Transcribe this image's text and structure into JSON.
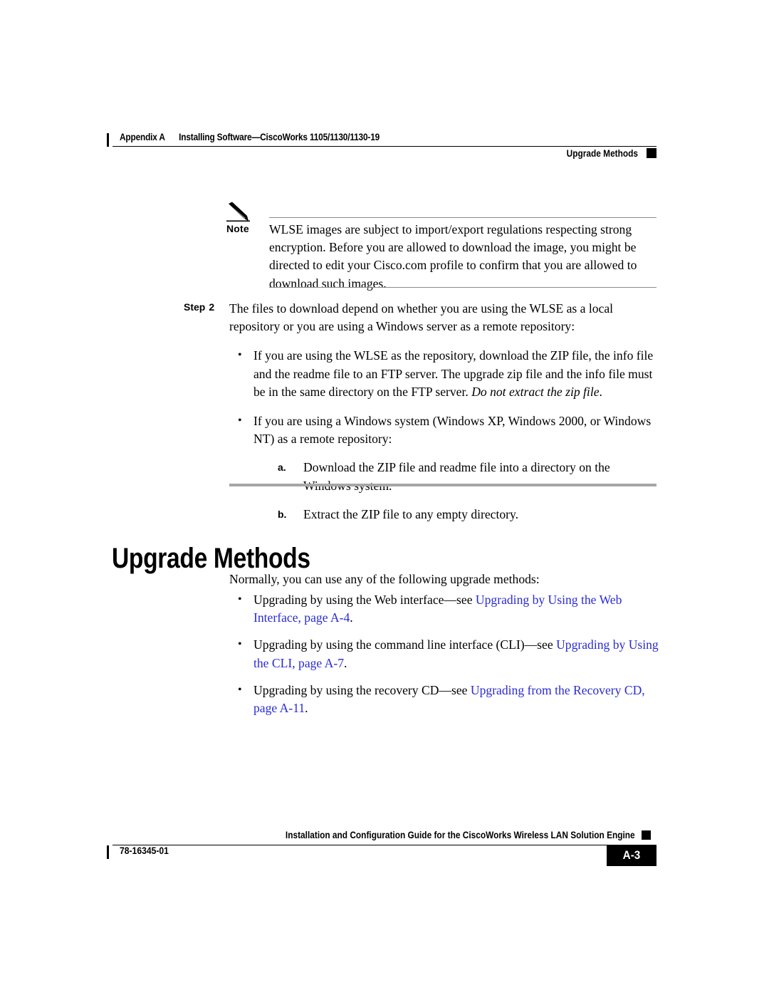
{
  "header": {
    "appendix": "Appendix A",
    "chapter_title": "Installing Software—CiscoWorks 1105/1130/1130-19",
    "section_name": "Upgrade Methods"
  },
  "note": {
    "label": "Note",
    "text": "WLSE images are subject to import/export regulations respecting strong encryption. Before you are allowed to download the image, you might be directed to edit your Cisco.com profile to confirm that you are allowed to download such images."
  },
  "step": {
    "label": "Step",
    "number": "2",
    "text": "The files to download depend on whether you are using the WLSE as a local repository or you are using a Windows server as a remote repository:",
    "bullets": [
      {
        "text_before_italic": "If you are using the WLSE as the repository, download the ZIP file, the info file and the readme file to an FTP server. The upgrade zip file and the info file must be in the same directory on the FTP server. ",
        "italic": "Do not extract the zip file",
        "text_after_italic": "."
      },
      {
        "text_before_italic": "If you are using a Windows system (Windows XP, Windows 2000, or Windows NT) as a remote repository:",
        "italic": "",
        "text_after_italic": ""
      }
    ],
    "sub_items": [
      {
        "marker": "a.",
        "text": "Download the ZIP file and readme file into a directory on the Windows system."
      },
      {
        "marker": "b.",
        "text": "Extract the ZIP file to any empty directory."
      }
    ]
  },
  "section": {
    "title": "Upgrade Methods",
    "intro": "Normally, you can use any of the following upgrade methods:",
    "methods": [
      {
        "lead": "Upgrading by using the Web interface—see ",
        "link": "Upgrading by Using the Web Interface, page A-4",
        "tail": "."
      },
      {
        "lead": "Upgrading by using the command line interface (CLI)—see ",
        "link": "Upgrading by Using the CLI, page A-7",
        "tail": "."
      },
      {
        "lead": "Upgrading by using the recovery CD—see ",
        "link": "Upgrading from the Recovery CD, page A-11",
        "tail": "."
      }
    ]
  },
  "footer": {
    "guide_title": "Installation and Configuration Guide for the CiscoWorks Wireless LAN Solution Engine",
    "doc_number": "78-16345-01",
    "page_number": "A-3"
  },
  "colors": {
    "link": "#2a2ad6",
    "rule_gray": "#8c8c8c",
    "section_rule_gray": "#a6a6a6",
    "ink": "#000000",
    "page_background": "#ffffff"
  }
}
